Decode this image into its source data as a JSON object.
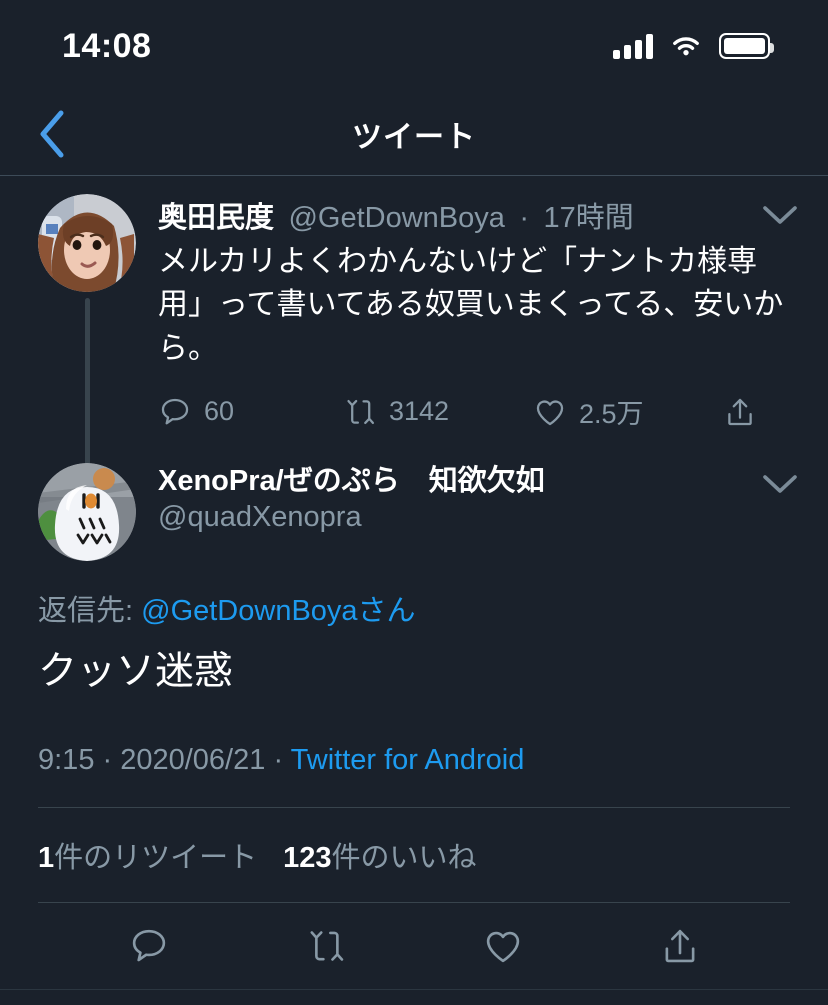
{
  "status_bar": {
    "time": "14:08",
    "icons": [
      "cellular-signal-icon",
      "wifi-icon",
      "battery-icon"
    ]
  },
  "nav": {
    "title": "ツイート",
    "back_icon": "back-chevron-icon",
    "accent_color": "#1d9bf0"
  },
  "colors": {
    "background": "#1a212b",
    "text_primary": "#ffffff",
    "text_secondary": "#8899a6",
    "link": "#1d9bf0",
    "divider": "#38444d",
    "thread_line": "#38444d"
  },
  "parent_tweet": {
    "display_name": "奥田民度",
    "handle": "@GetDownBoya",
    "separator": "·",
    "time_ago": "17時間",
    "text": "メルカリよくわかんないけど「ナントカ様専用」って書いてある奴買いまくってる、安いから。",
    "caret_icon": "chevron-down-icon",
    "actions": [
      {
        "icon": "reply-icon",
        "count": "60"
      },
      {
        "icon": "retweet-icon",
        "count": "3142"
      },
      {
        "icon": "like-icon",
        "count": "2.5万"
      },
      {
        "icon": "share-icon",
        "count": ""
      }
    ]
  },
  "detail_tweet": {
    "display_name": "XenoPra/ぜのぷら　知欲欠如",
    "handle": "@quadXenopra",
    "caret_icon": "chevron-down-icon",
    "reply_to_label": "返信先: ",
    "reply_to_user": "@GetDownBoyaさん",
    "text": "クッソ迷惑",
    "time": "9:15",
    "sep1": " · ",
    "date": "2020/06/21",
    "sep2": " · ",
    "source": "Twitter for Android",
    "stats": {
      "retweet_count": "1",
      "retweet_label": "件のリツイート",
      "like_count": "123",
      "like_label": "件のいいね"
    },
    "action_bar": [
      {
        "icon": "reply-icon"
      },
      {
        "icon": "retweet-icon"
      },
      {
        "icon": "like-icon"
      },
      {
        "icon": "share-icon"
      }
    ]
  }
}
